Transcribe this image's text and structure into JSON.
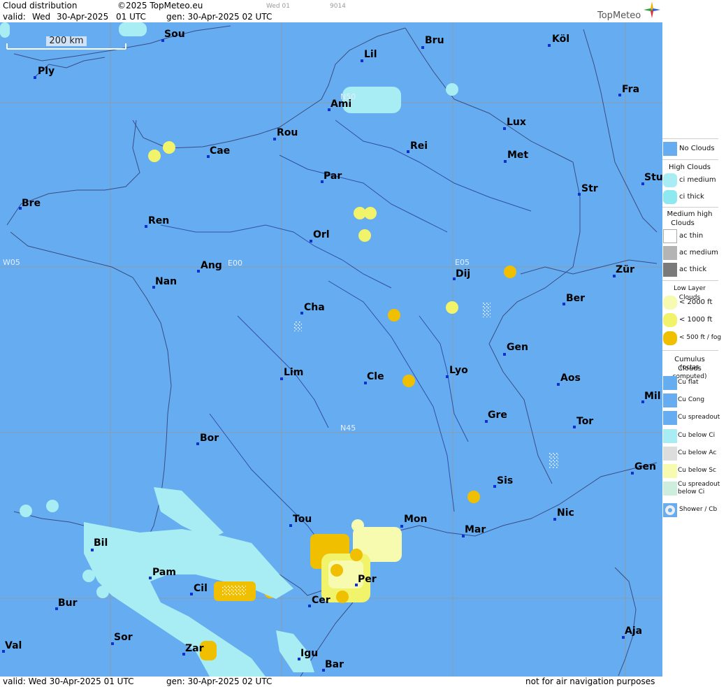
{
  "header": {
    "title": "Cloud distribution",
    "copyright": "©2025 TopMeteo.eu",
    "valid_label": "valid:",
    "valid_day": "Wed",
    "valid_date": "30-Apr-2025",
    "valid_time": "01 UTC",
    "gen": "gen: 30-Apr-2025 02 UTC",
    "mini_day": "Wed 01",
    "mini_code": "9014",
    "brand": "TopMeteo"
  },
  "footer": {
    "valid": "valid:  Wed  30-Apr-2025  01 UTC",
    "gen": "gen: 30-Apr-2025 02 UTC",
    "disclaimer": "not for air navigation purposes"
  },
  "map": {
    "scale": "200 km",
    "coords": {
      "w05": "W05",
      "e00": "E00",
      "e05": "E05",
      "n50": "N50",
      "n45": "N45"
    },
    "cities": {
      "sou": "Sou",
      "ply": "Ply",
      "lil": "Lil",
      "bru": "Bru",
      "kol": "Köl",
      "ami": "Ami",
      "fra": "Fra",
      "rou": "Rou",
      "cae": "Cae",
      "lux": "Lux",
      "rei": "Rei",
      "met": "Met",
      "par": "Par",
      "stu": "Stu",
      "str": "Str",
      "bre": "Bre",
      "ren": "Ren",
      "orl": "Orl",
      "ang": "Ang",
      "nan": "Nan",
      "dij": "Dij",
      "zur": "Zür",
      "cha": "Cha",
      "ber": "Ber",
      "gen1": "Gen",
      "lim": "Lim",
      "cle": "Cle",
      "lyo": "Lyo",
      "aos": "Aos",
      "mil": "Mil",
      "gre": "Gre",
      "tor": "Tor",
      "bor": "Bor",
      "gen2": "Gen",
      "sis": "Sis",
      "tou": "Tou",
      "mon": "Mon",
      "nic": "Nic",
      "mar": "Mar",
      "bil": "Bil",
      "pam": "Pam",
      "per": "Per",
      "cil": "Cil",
      "bur": "Bur",
      "cer": "Cer",
      "sor": "Sor",
      "val": "Val",
      "zar": "Zar",
      "igu": "Igu",
      "bar": "Bar",
      "aja": "Aja"
    }
  },
  "legend": {
    "no_clouds": "No Clouds",
    "high_title": "High Clouds",
    "ci_medium": "ci medium",
    "ci_thick": "ci thick",
    "medium_title_1": "Medium high",
    "medium_title_2": "Clouds",
    "ac_thin": "ac thin",
    "ac_medium": "ac medium",
    "ac_thick": "ac thick",
    "low_title": "Low Layer Clouds",
    "low_2000": "< 2000 ft",
    "low_1000": "< 1000 ft",
    "low_500": "< 500 ft / fog",
    "cu_title_1": "Cumulus Clouds",
    "cu_title_2": "(octas computed)",
    "cu_flat": "Cu flat",
    "cu_cong": "Cu Cong",
    "cu_spread": "Cu spreadout",
    "cu_below_ci": "Cu below Ci",
    "cu_below_ac": "Cu below Ac",
    "cu_below_sc": "Cu below Sc",
    "cu_spread_ci_1": "Cu spreadout",
    "cu_spread_ci_2": "below Ci",
    "shower": "Shower / Cb"
  },
  "colors": {
    "no_clouds": "#65adf0",
    "ci_medium": "#a8ecf4",
    "ci_thick": "#8ee8f0",
    "ac_thin": "#ffffff",
    "ac_medium": "#b4b4b4",
    "ac_thick": "#7a7a7a",
    "low_2000": "#f7fbb0",
    "low_1000": "#f1f36a",
    "low_500": "#f0c000"
  }
}
